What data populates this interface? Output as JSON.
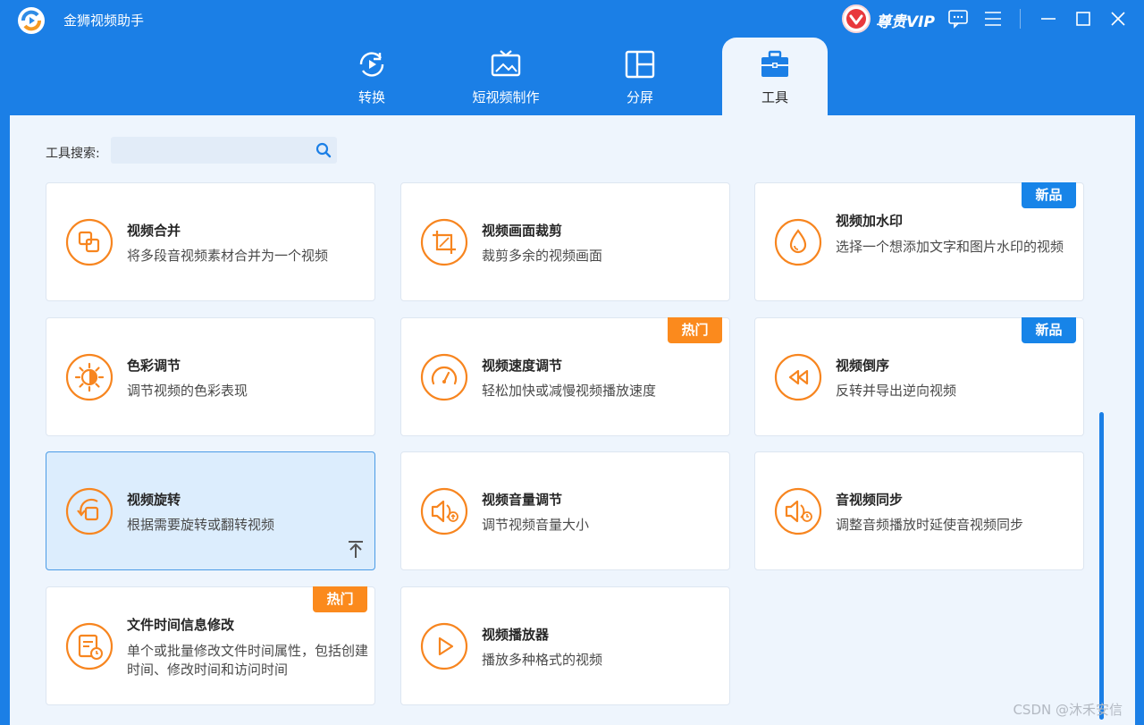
{
  "app": {
    "title": "金狮视频助手",
    "vip_label": "尊贵VIP"
  },
  "tabs": [
    {
      "label": "转换",
      "icon": "convert-icon"
    },
    {
      "label": "短视频制作",
      "icon": "short-video-icon"
    },
    {
      "label": "分屏",
      "icon": "split-screen-icon"
    },
    {
      "label": "工具",
      "icon": "toolbox-icon",
      "active": true
    }
  ],
  "search": {
    "label": "工具搜索:",
    "placeholder": ""
  },
  "tools": [
    {
      "title": "视频合并",
      "desc": "将多段音视频素材合并为一个视频",
      "icon": "merge-icon",
      "badge": ""
    },
    {
      "title": "视频画面裁剪",
      "desc": "裁剪多余的视频画面",
      "icon": "crop-icon",
      "badge": ""
    },
    {
      "title": "视频加水印",
      "desc": "选择一个想添加文字和图片水印的视频",
      "icon": "watermark-drop-icon",
      "badge": "新品"
    },
    {
      "title": "色彩调节",
      "desc": "调节视频的色彩表现",
      "icon": "brightness-icon",
      "badge": ""
    },
    {
      "title": "视频速度调节",
      "desc": "轻松加快或减慢视频播放速度",
      "icon": "speedometer-icon",
      "badge": "热门"
    },
    {
      "title": "视频倒序",
      "desc": "反转并导出逆向视频",
      "icon": "rewind-icon",
      "badge": "新品"
    },
    {
      "title": "视频旋转",
      "desc": "根据需要旋转或翻转视频",
      "icon": "rotate-icon",
      "badge": ""
    },
    {
      "title": "视频音量调节",
      "desc": "调节视频音量大小",
      "icon": "volume-up-icon",
      "badge": ""
    },
    {
      "title": "音视频同步",
      "desc": "调整音频播放时延使音视频同步",
      "icon": "audio-sync-icon",
      "badge": ""
    },
    {
      "title": "文件时间信息修改",
      "desc": "单个或批量修改文件时间属性，包括创建时间、修改时间和访问时间",
      "icon": "file-time-icon",
      "badge": "热门"
    },
    {
      "title": "视频播放器",
      "desc": "播放多种格式的视频",
      "icon": "play-icon",
      "badge": ""
    }
  ],
  "watermark": "CSDN @沐禾安信",
  "colors": {
    "primary": "#1b7fe6",
    "accent": "#fb8a1d",
    "new_badge": "#1784e8",
    "content_bg": "#eef5fd"
  }
}
